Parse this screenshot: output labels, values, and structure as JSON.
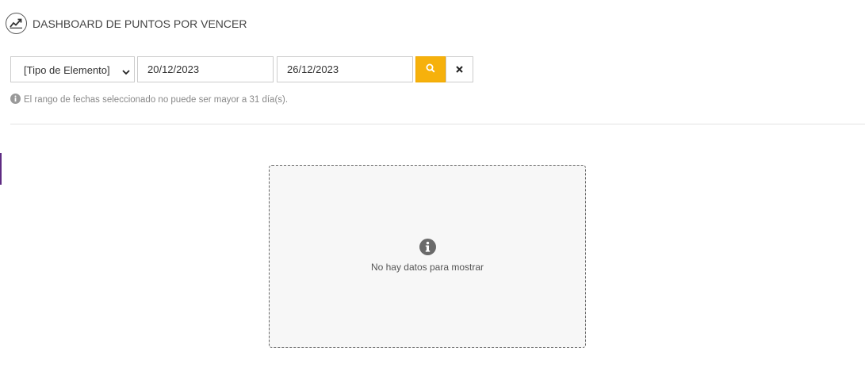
{
  "header": {
    "title": "DASHBOARD DE PUNTOS POR VENCER",
    "icon": "line-chart-icon"
  },
  "filters": {
    "element_type": {
      "selected": "[Tipo de Elemento]"
    },
    "date_start": {
      "value": "20/12/2023"
    },
    "date_end": {
      "value": "26/12/2023"
    },
    "search_icon": "search-icon",
    "clear_icon": "close-icon"
  },
  "hint": {
    "icon": "info-circle-icon",
    "text": "El rango de fechas seleccionado no puede ser mayor a 31 día(s)."
  },
  "empty_state": {
    "icon": "info-circle-icon",
    "text": "No hay datos para mostrar"
  },
  "colors": {
    "accent": "#f6b10c",
    "side_accent": "#5e2b82",
    "empty_bg": "#f7f7f7"
  }
}
